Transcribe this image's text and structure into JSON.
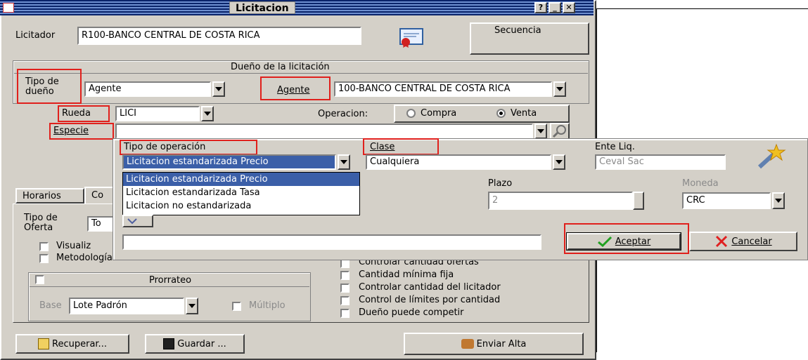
{
  "window": {
    "title": "Licitacion"
  },
  "licitador": {
    "label": "Licitador",
    "value": "R100-BANCO CENTRAL DE COSTA RICA",
    "secuencia_label": "Secuencia"
  },
  "dueno": {
    "group_title": "Dueño de la licitación",
    "tipo_label": "Tipo de dueño",
    "tipo_value": "Agente",
    "agente_label": "Agente",
    "agente_value": "100-BANCO CENTRAL DE COSTA RICA"
  },
  "rueda": {
    "label": "Rueda",
    "value": "LICI"
  },
  "operacion": {
    "label": "Operacion:",
    "options": [
      "Compra",
      "Venta"
    ],
    "selected": "Venta"
  },
  "especie": {
    "label": "Especie",
    "value": ""
  },
  "tabs": [
    {
      "label": "Horarios"
    },
    {
      "label": "Co"
    }
  ],
  "left_form": {
    "tipo_oferta_label": "Tipo de Oferta",
    "tipo_oferta_value": "To",
    "visualiz_label": "Visualiz",
    "metodologia_label": "Metodología Holandesa",
    "prorrateo_title": "Prorrateo",
    "base_label": "Base",
    "base_value": "Lote Padrón",
    "multiplo_label": "Múltiplo"
  },
  "checkboxes": [
    {
      "label": "Controlar cantidad ofertas"
    },
    {
      "label": "Cantidad mínima fija"
    },
    {
      "label": "Controlar cantidad del licitador"
    },
    {
      "label": "Control de límites por cantidad"
    },
    {
      "label": "Dueño puede competir"
    }
  ],
  "bottom_buttons": {
    "recuperar": "Recuperar...",
    "guardar": "Guardar ...",
    "enviar": "Enviar Alta"
  },
  "popup": {
    "tipo_operacion_label": "Tipo de operación",
    "tipo_operacion_value": "Licitacion estandarizada Precio",
    "tipo_operacion_options": [
      "Licitacion estandarizada Precio",
      "Licitacion estandarizada Tasa",
      "Licitacion no estandarizada"
    ],
    "clase_label": "Clase",
    "clase_value": "Cualquiera",
    "ente_label": "Ente Liq.",
    "ente_value": "Ceval Sac",
    "plazo_label": "Plazo",
    "plazo_value": "2",
    "moneda_label": "Moneda",
    "moneda_value": "CRC",
    "aceptar": "Aceptar",
    "cancelar": "Cancelar"
  }
}
